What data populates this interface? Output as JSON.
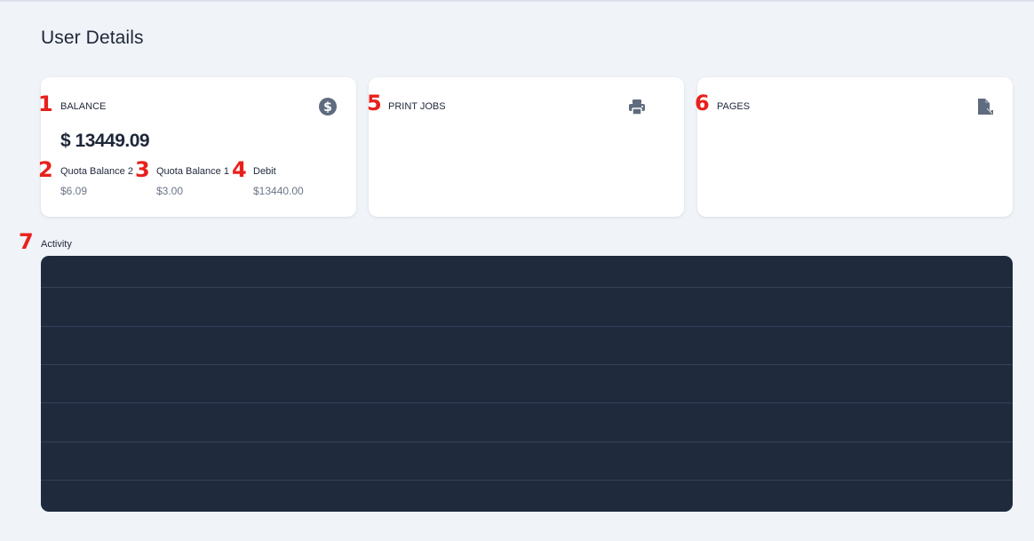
{
  "page": {
    "title": "User Details"
  },
  "cards": {
    "balance": {
      "label": "BALANCE",
      "icon": "dollar-circle-icon",
      "amount": "$ 13449.09",
      "breakdown": [
        {
          "label": "Quota Balance 2",
          "value": "$6.09"
        },
        {
          "label": "Quota Balance 1",
          "value": "$3.00"
        },
        {
          "label": "Debit",
          "value": "$13440.00"
        }
      ]
    },
    "print_jobs": {
      "label": "PRINT JOBS",
      "icon": "printer-icon"
    },
    "pages": {
      "label": "PAGES",
      "icon": "file-export-icon"
    }
  },
  "activity": {
    "label": "Activity",
    "rows": 6
  },
  "annotations": [
    "1",
    "2",
    "3",
    "4",
    "5",
    "6",
    "7"
  ],
  "colors": {
    "background": "#f0f3f8",
    "card": "#ffffff",
    "text": "#1e2738",
    "muted": "#6b7588",
    "icon": "#5f6b7e",
    "panel": "#1f2a3c",
    "annotation": "#e8201c"
  }
}
